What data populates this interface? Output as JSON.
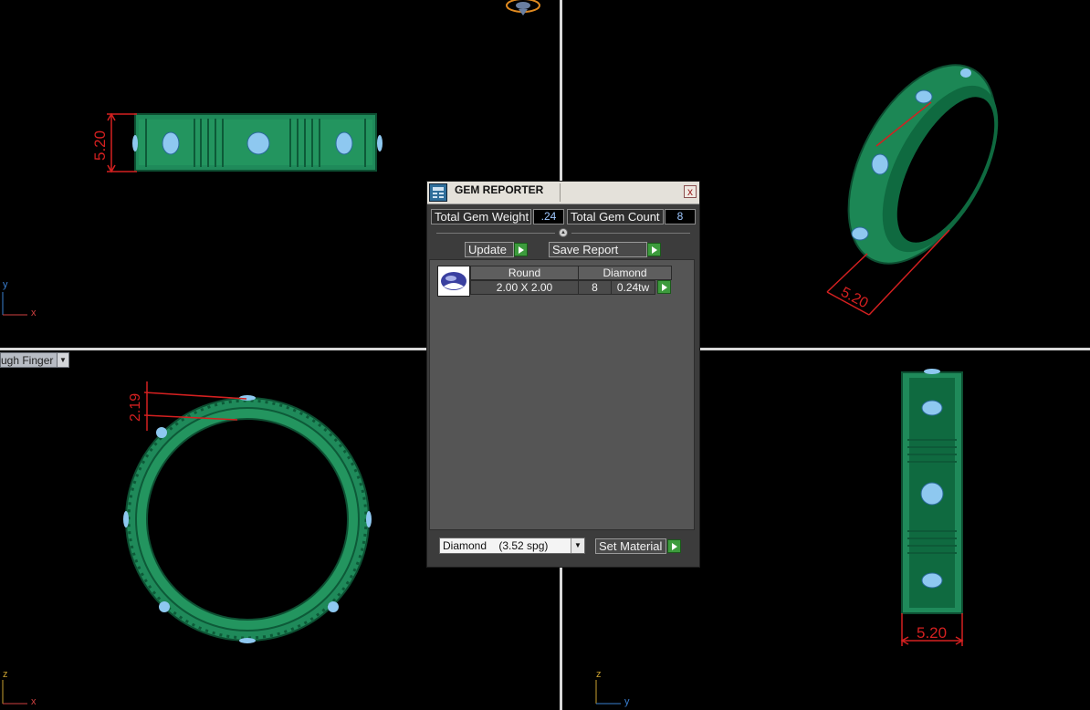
{
  "viewport": {
    "dropdown_label": "ugh Finger",
    "axes": {
      "top_left": {
        "v": "y",
        "h": "x"
      },
      "bottom_left": {
        "v": "z",
        "h": "x"
      },
      "bottom_right": {
        "v": "z",
        "h": "y"
      }
    },
    "dimensions": {
      "front_height": "5.20",
      "side_thickness": "2.19",
      "perspective_width": "5.20",
      "top_width": "5.20"
    },
    "colors": {
      "ring": "#1f8a5a",
      "gem": "#8ec8f0",
      "dim": "#d42020",
      "grid": "#d8d8d8"
    }
  },
  "gem_reporter": {
    "title": "GEM REPORTER",
    "close_label": "x",
    "total_weight_label": "Total Gem Weight",
    "total_weight_value": ".24",
    "total_count_label": "Total Gem Count",
    "total_count_value": "8",
    "update_label": "Update",
    "save_report_label": "Save Report",
    "table": {
      "headers": [
        "Round",
        "Diamond"
      ],
      "row": {
        "size": "2.00 X 2.00",
        "count": "8",
        "weight": "0.24tw"
      }
    },
    "material_select": "Diamond    (3.52 spg)",
    "set_material_label": "Set Material"
  }
}
